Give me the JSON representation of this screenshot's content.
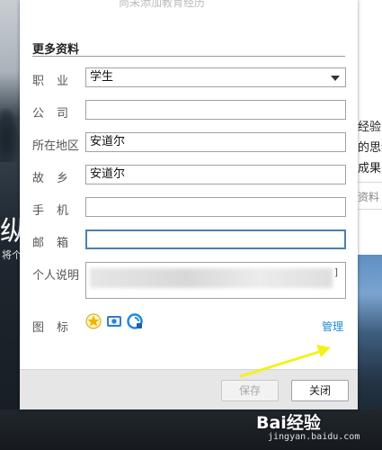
{
  "dialog": {
    "top_hint": "尚未添加教育经历",
    "section_title": "更多资料",
    "fields": {
      "occupation": {
        "label": "职业",
        "value": "学生"
      },
      "company": {
        "label": "公司",
        "value": ""
      },
      "location": {
        "label": "所在地区",
        "value": "安道尔"
      },
      "hometown": {
        "label": "故乡",
        "value": "安道尔"
      },
      "phone": {
        "label": "手机",
        "value": ""
      },
      "email": {
        "label": "邮箱",
        "value": ""
      },
      "bio": {
        "label": "个人说明"
      }
    },
    "icons_label": "图标",
    "icons": [
      "star-badge-icon",
      "photo-app-icon",
      "qq-browser-icon"
    ],
    "manage_label": "管理",
    "save_label": "保存",
    "close_label": "关闭"
  },
  "background": {
    "right_lines": [
      "经验的",
      "的思维",
      "成果安",
      "资料"
    ],
    "left_big_char": "纵",
    "left_small_text": "将个",
    "watermark": "Bai经验",
    "watermark_url": "jingyan.baidu.com"
  },
  "colors": {
    "accent": "#1b8bd0",
    "focus_border": "#4a7fb8",
    "arrow": "#f2f21a"
  }
}
